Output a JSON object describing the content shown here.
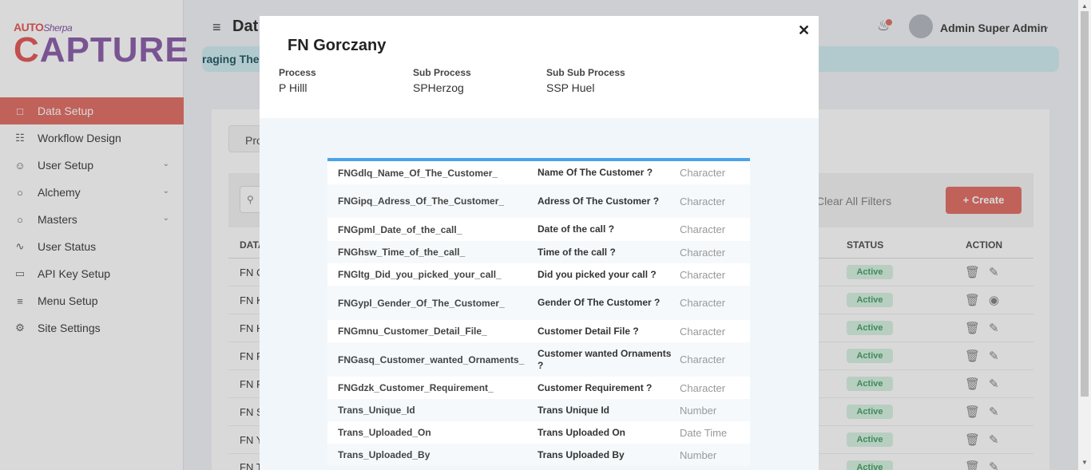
{
  "logo": {
    "auto": "AUTO",
    "sherpa": "Sherpa",
    "capture_c": "C",
    "capture_rest": "APTURE"
  },
  "sidebar": {
    "items": [
      {
        "label": "Data Setup",
        "icon": "clipboard-icon"
      },
      {
        "label": "Workflow Design",
        "icon": "sitemap-icon"
      },
      {
        "label": "User Setup",
        "icon": "users-icon"
      },
      {
        "label": "Alchemy",
        "icon": "circle-icon"
      },
      {
        "label": "Masters",
        "icon": "circle-icon"
      },
      {
        "label": "User Status",
        "icon": "activity-icon"
      },
      {
        "label": "API Key Setup",
        "icon": "monitor-icon"
      },
      {
        "label": "Menu Setup",
        "icon": "menu-icon"
      },
      {
        "label": "Site Settings",
        "icon": "gear-icon"
      }
    ]
  },
  "header": {
    "title": "Dat",
    "user": "Admin Super Admin"
  },
  "banner": {
    "text": "raging The"
  },
  "background": {
    "tab": "Pro",
    "clear_filters": "Clear All Filters",
    "create": "+ Create",
    "columns": {
      "data": "DATA",
      "status": "STATUS",
      "action": "ACTION"
    },
    "rows": [
      {
        "name": "FN C",
        "status": "Active",
        "action_icon": "pencil-icon"
      },
      {
        "name": "FN K",
        "status": "Active",
        "action_icon": "eye-icon"
      },
      {
        "name": "FN H",
        "status": "Active",
        "action_icon": "pencil-icon"
      },
      {
        "name": "FN F",
        "status": "Active",
        "action_icon": "pencil-icon"
      },
      {
        "name": "FN F",
        "status": "Active",
        "action_icon": "pencil-icon"
      },
      {
        "name": "FN S",
        "status": "Active",
        "action_icon": "pencil-icon"
      },
      {
        "name": "FN Y",
        "status": "Active",
        "action_icon": "pencil-icon"
      },
      {
        "name": "FN T",
        "status": "Active",
        "action_icon": "pencil-icon"
      }
    ]
  },
  "modal": {
    "title": "FN Gorczany",
    "process_label": "Process",
    "process_value": "P Hilll",
    "subprocess_label": "Sub Process",
    "subprocess_value": "SPHerzog",
    "subsubprocess_label": "Sub Sub Process",
    "subsubprocess_value": "SSP Huel",
    "fields": [
      {
        "field": "FNGdlq_Name_Of_The_Customer_",
        "label": "Name Of The Customer ?",
        "type": "Character"
      },
      {
        "field": "FNGipq_Adress_Of_The_Customer_",
        "label": "Adress Of The Customer ?",
        "type": "Character"
      },
      {
        "field": "FNGpml_Date_of_the_call_",
        "label": "Date of the call ?",
        "type": "Character"
      },
      {
        "field": "FNGhsw_Time_of_the_call_",
        "label": "Time of the call ?",
        "type": "Character"
      },
      {
        "field": "FNGltg_Did_you_picked_your_call_",
        "label": "Did you picked your call ?",
        "type": "Character"
      },
      {
        "field": "FNGypl_Gender_Of_The_Customer_",
        "label": "Gender Of The Customer ?",
        "type": "Character"
      },
      {
        "field": "FNGmnu_Customer_Detail_File_",
        "label": "Customer Detail File ?",
        "type": "Character"
      },
      {
        "field": "FNGasq_Customer_wanted_Ornaments_",
        "label": "Customer wanted Ornaments ?",
        "type": "Character"
      },
      {
        "field": "FNGdzk_Customer_Requirement_",
        "label": "Customer Requirement ?",
        "type": "Character"
      },
      {
        "field": "Trans_Unique_Id",
        "label": "Trans Unique Id",
        "type": "Number"
      },
      {
        "field": "Trans_Uploaded_On",
        "label": "Trans Uploaded On",
        "type": "Date Time"
      },
      {
        "field": "Trans_Uploaded_By",
        "label": "Trans Uploaded By",
        "type": "Number"
      }
    ]
  }
}
